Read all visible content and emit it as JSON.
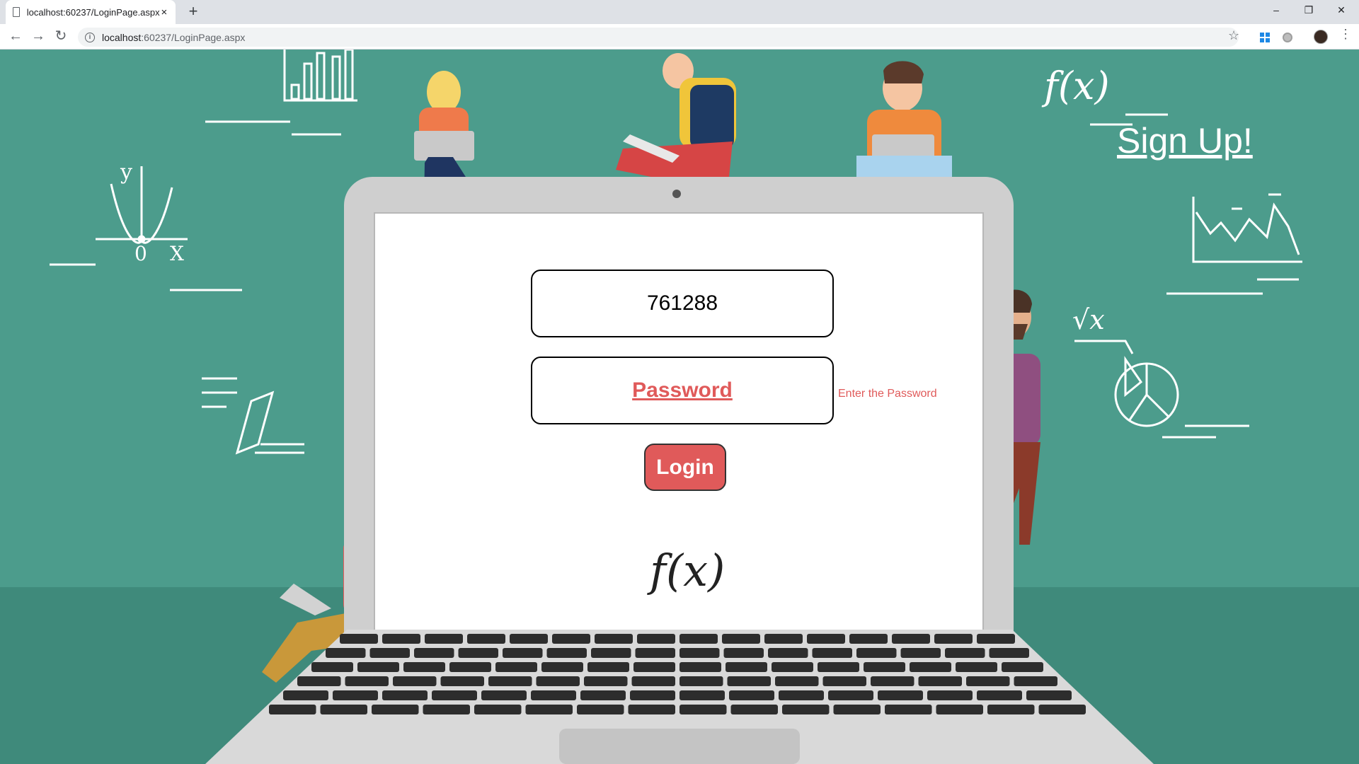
{
  "browser": {
    "tab_title": "localhost:60237/LoginPage.aspx",
    "tab_close": "×",
    "new_tab": "+",
    "url_host": "localhost",
    "url_rest": ":60237/LoginPage.aspx",
    "window_controls": [
      "–",
      "❐",
      "✕"
    ]
  },
  "page": {
    "signup_link": "Sign Up!",
    "username_value": "761288",
    "password_placeholder": "Password",
    "password_hint": "Enter the Password",
    "login_button": "Login",
    "math_labels": {
      "fx_top": "f(x)",
      "sqrt_x": "√x",
      "y_axis": "y",
      "zero": "0",
      "x_axis": "X"
    }
  },
  "colors": {
    "background": "#4c9c8c",
    "accent": "#e05a5a",
    "laptop": "#cfcfcf"
  }
}
